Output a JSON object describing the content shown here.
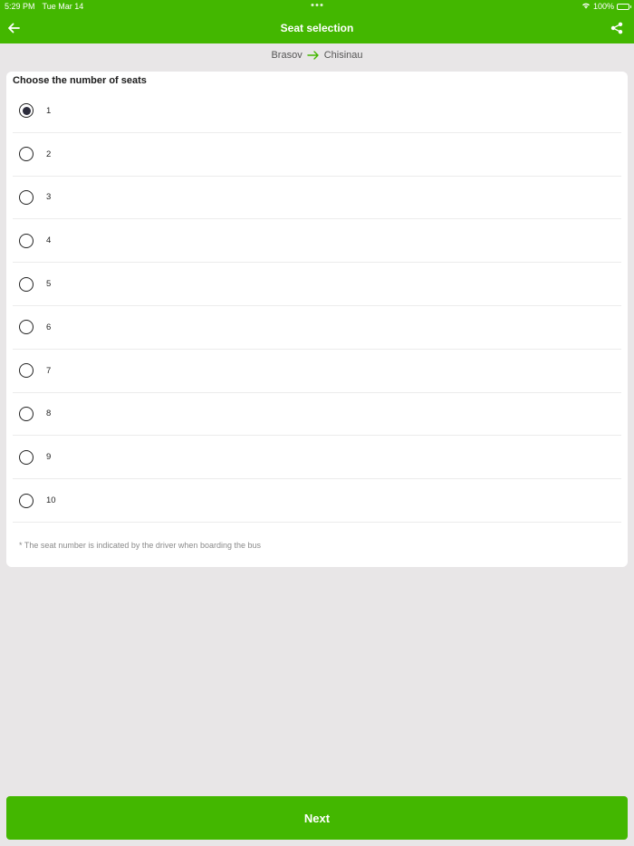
{
  "status_bar": {
    "time": "5:29 PM",
    "date": "Tue Mar 14",
    "battery": "100%",
    "wifi_icon": "wifi-icon",
    "battery_icon": "battery-icon"
  },
  "header": {
    "title": "Seat selection",
    "back_icon": "arrow-left-icon",
    "share_icon": "share-icon",
    "accent_color": "#43b700"
  },
  "route": {
    "from": "Brasov",
    "to": "Chisinau",
    "arrow_icon": "arrow-right-icon"
  },
  "seat_selection": {
    "heading": "Choose the number of seats",
    "selected": "1",
    "options": [
      {
        "label": "1"
      },
      {
        "label": "2"
      },
      {
        "label": "3"
      },
      {
        "label": "4"
      },
      {
        "label": "5"
      },
      {
        "label": "6"
      },
      {
        "label": "7"
      },
      {
        "label": "8"
      },
      {
        "label": "9"
      },
      {
        "label": "10"
      }
    ],
    "note": "* The seat number is indicated by the driver when boarding the bus"
  },
  "footer": {
    "next_label": "Next"
  }
}
